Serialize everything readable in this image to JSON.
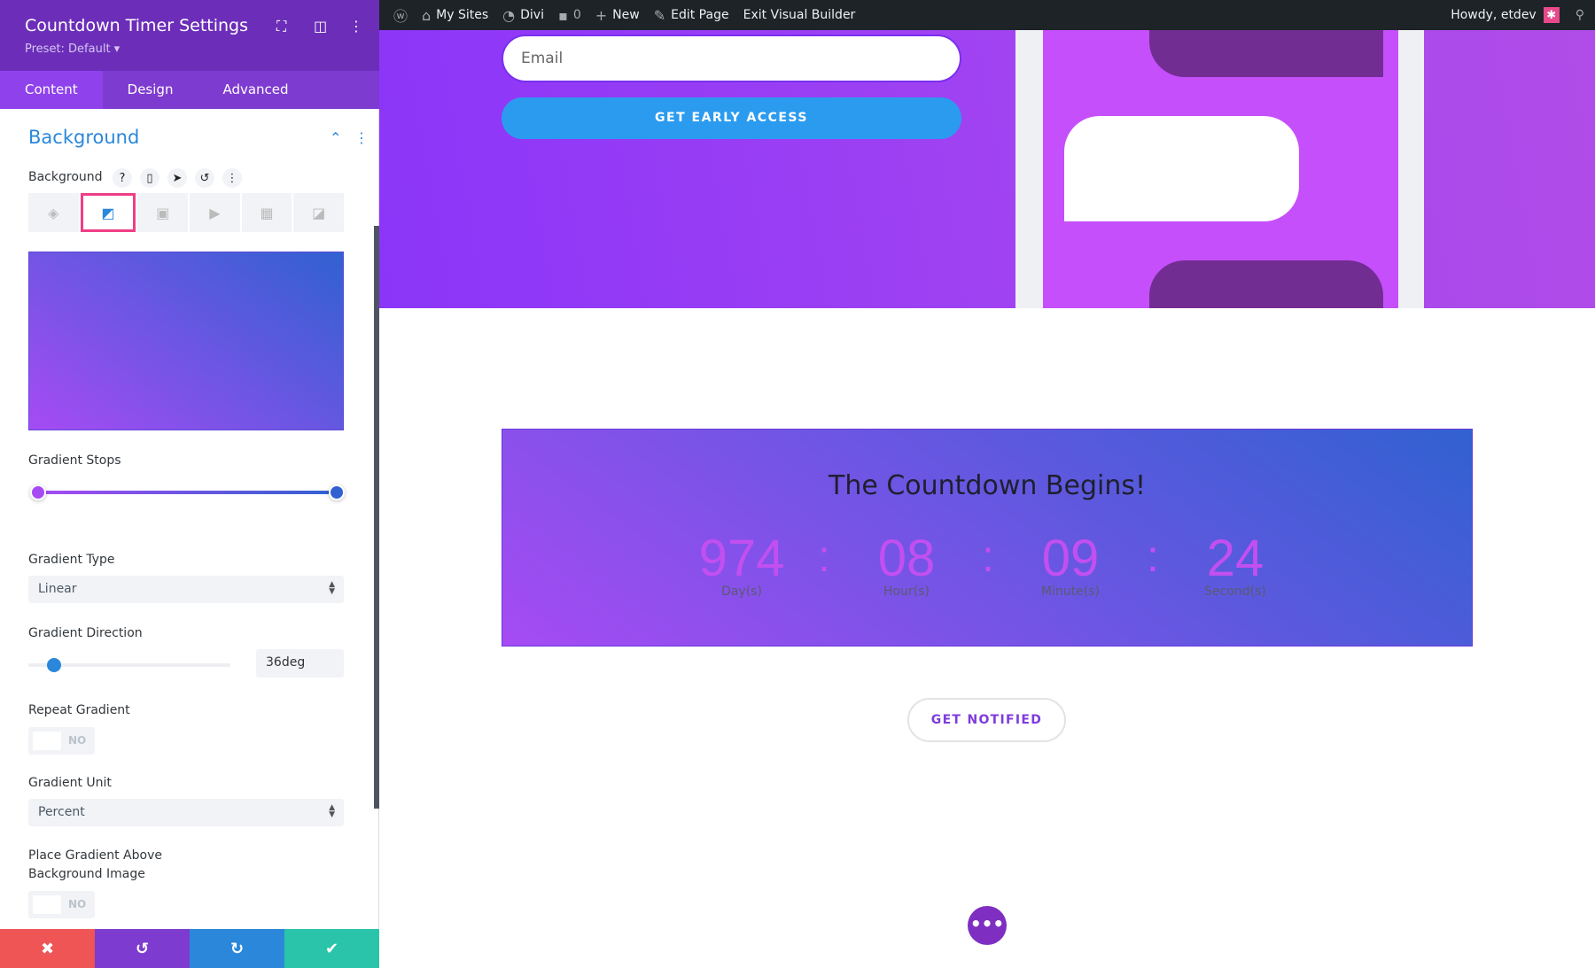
{
  "adminbar": {
    "my_sites": "My Sites",
    "divi": "Divi",
    "comments": "0",
    "new": "New",
    "edit_page": "Edit Page",
    "exit_builder": "Exit Visual Builder",
    "howdy": "Howdy, etdev"
  },
  "panel": {
    "title": "Countdown Timer Settings",
    "preset": "Preset: Default ▾",
    "tabs": [
      "Content",
      "Design",
      "Advanced"
    ],
    "section": "Background",
    "bg_label": "Background",
    "gradient_stops_label": "Gradient Stops",
    "gradient_start_color": "#a64bf4",
    "gradient_end_color": "#3161d1",
    "gradient_type_label": "Gradient Type",
    "gradient_type": "Linear",
    "gradient_direction_label": "Gradient Direction",
    "gradient_direction": "36deg",
    "gradient_direction_value": 36,
    "repeat_label": "Repeat Gradient",
    "repeat_value": "NO",
    "unit_label": "Gradient Unit",
    "unit_value": "Percent",
    "place_above_label_1": "Place Gradient Above",
    "place_above_label_2": "Background Image",
    "place_above_value": "NO"
  },
  "hero": {
    "email_placeholder": "Email",
    "cta": "GET EARLY ACCESS"
  },
  "countdown": {
    "title": "The Countdown Begins!",
    "items": [
      {
        "value": "974",
        "unit": "Day(s)"
      },
      {
        "value": "08",
        "unit": "Hour(s)"
      },
      {
        "value": "09",
        "unit": "Minute(s)"
      },
      {
        "value": "24",
        "unit": "Second(s)"
      }
    ],
    "separator": ":"
  },
  "notify": "GET NOTIFIED",
  "colors": {
    "accent": "#2b87da",
    "header": "#6c2eb9",
    "selected_border": "#ef3e86"
  }
}
